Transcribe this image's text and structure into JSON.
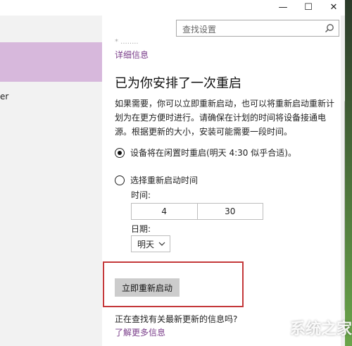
{
  "window": {
    "minimize_label": "—",
    "maximize_label": "☐",
    "close_label": "✕"
  },
  "search": {
    "placeholder": "查找设置"
  },
  "sidebar": {
    "partial_item": "er"
  },
  "content": {
    "top_partial": "* ........",
    "details_link": "详细信息",
    "heading": "已为你安排了一次重启",
    "description": "如果需要，你可以立即重新启动，也可以将重新启动重新计划为在更方便时进行。请确保在计划的时间将设备接通电源。根据更新的大小，安装可能需要一段时间。",
    "option_auto": "设备将在闲置时重启(明天 4:30 似乎合适)。",
    "option_choose": "选择重新启动时间",
    "time_label": "时间:",
    "time_hour": "4",
    "time_minute": "30",
    "date_label": "日期:",
    "date_value": "明天",
    "restart_button": "立即重新启动",
    "checking_text": "正在查找有关最新更新的信息吗?",
    "learn_more": "了解更多信息"
  },
  "watermark": "系统之家",
  "colors": {
    "accent": "#7a3d8a",
    "selected": "#d7b8dc",
    "highlight": "#c4383a"
  }
}
